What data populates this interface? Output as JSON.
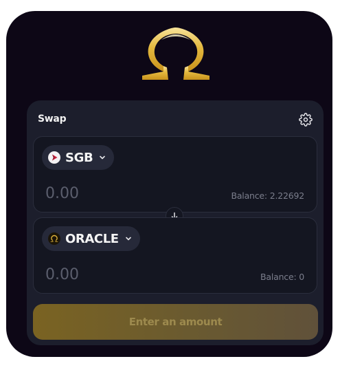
{
  "swap": {
    "title": "Swap",
    "settings_icon": "gear-icon",
    "from": {
      "token": "SGB",
      "token_icon": "songbird-icon",
      "amount_placeholder": "0.00",
      "balance_label": "Balance: 2.22692"
    },
    "switch_icon": "arrow-down-icon",
    "to": {
      "token": "ORACLE",
      "token_icon": "oracle-omega-icon",
      "amount_placeholder": "0.00",
      "balance_label": "Balance: 0"
    },
    "action_label": "Enter an amount"
  },
  "brand": {
    "logo_icon": "omega-logo-icon",
    "accent": "#e0b23a",
    "background": "#0d0716",
    "card": "#1c1e2c"
  }
}
